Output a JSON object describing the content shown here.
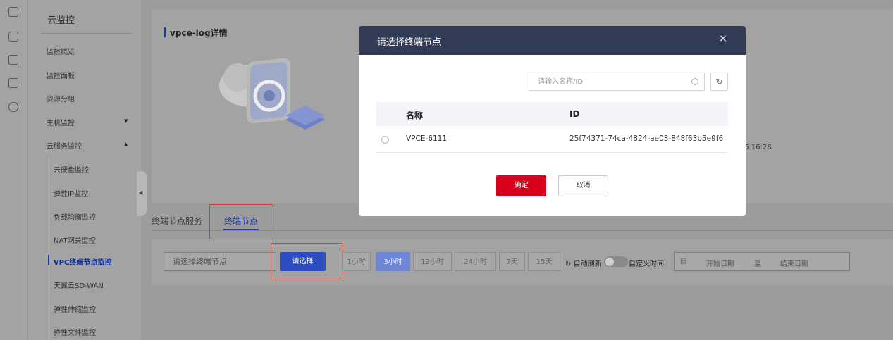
{
  "sidebar": {
    "title": "云监控",
    "items": [
      {
        "label": "监控概览"
      },
      {
        "label": "监控面板"
      },
      {
        "label": "资源分组"
      },
      {
        "label": "主机监控"
      },
      {
        "label": "云服务监控"
      },
      {
        "label": "云硬盘监控"
      },
      {
        "label": "弹性IP监控"
      },
      {
        "label": "负载均衡监控"
      },
      {
        "label": "NAT网关监控"
      },
      {
        "label": "VPC终端节点监控"
      },
      {
        "label": "天翼云SD-WAN"
      },
      {
        "label": "弹性伸缩监控"
      },
      {
        "label": "弹性文件监控"
      }
    ],
    "active": "VPC终端节点监控"
  },
  "detail": {
    "title": "vpce-log详情",
    "time_fragment": "6:16:28"
  },
  "tabs": [
    {
      "label": "终端节点服务"
    },
    {
      "label": "终端节点"
    }
  ],
  "filter": {
    "node_placeholder": "请选择终端节点",
    "choose_label": "请选择",
    "ranges": [
      "1小时",
      "3小时",
      "12小时",
      "24小时",
      "7天",
      "15天"
    ],
    "active_range": "3小时",
    "auto_refresh": "自动刷新",
    "custom_time": "自定义时间:",
    "start_date": "开始日期",
    "to": "至",
    "end_date": "结束日期"
  },
  "dialog": {
    "title": "请选择终端节点",
    "close": "×",
    "search_placeholder": "请输入名称/ID",
    "refresh": "↻",
    "columns": [
      "名称",
      "ID"
    ],
    "rows": [
      {
        "name": "VPCE-6111",
        "id": "25f74371-74ca-4824-ae03-848f63b5e9f6"
      }
    ],
    "ok": "确定",
    "cancel": "取消"
  },
  "colors": {
    "dialog_header": "#333c56",
    "primary": "#2d4ec2",
    "danger": "#d9001b",
    "highlight_box": "#e8352e"
  }
}
